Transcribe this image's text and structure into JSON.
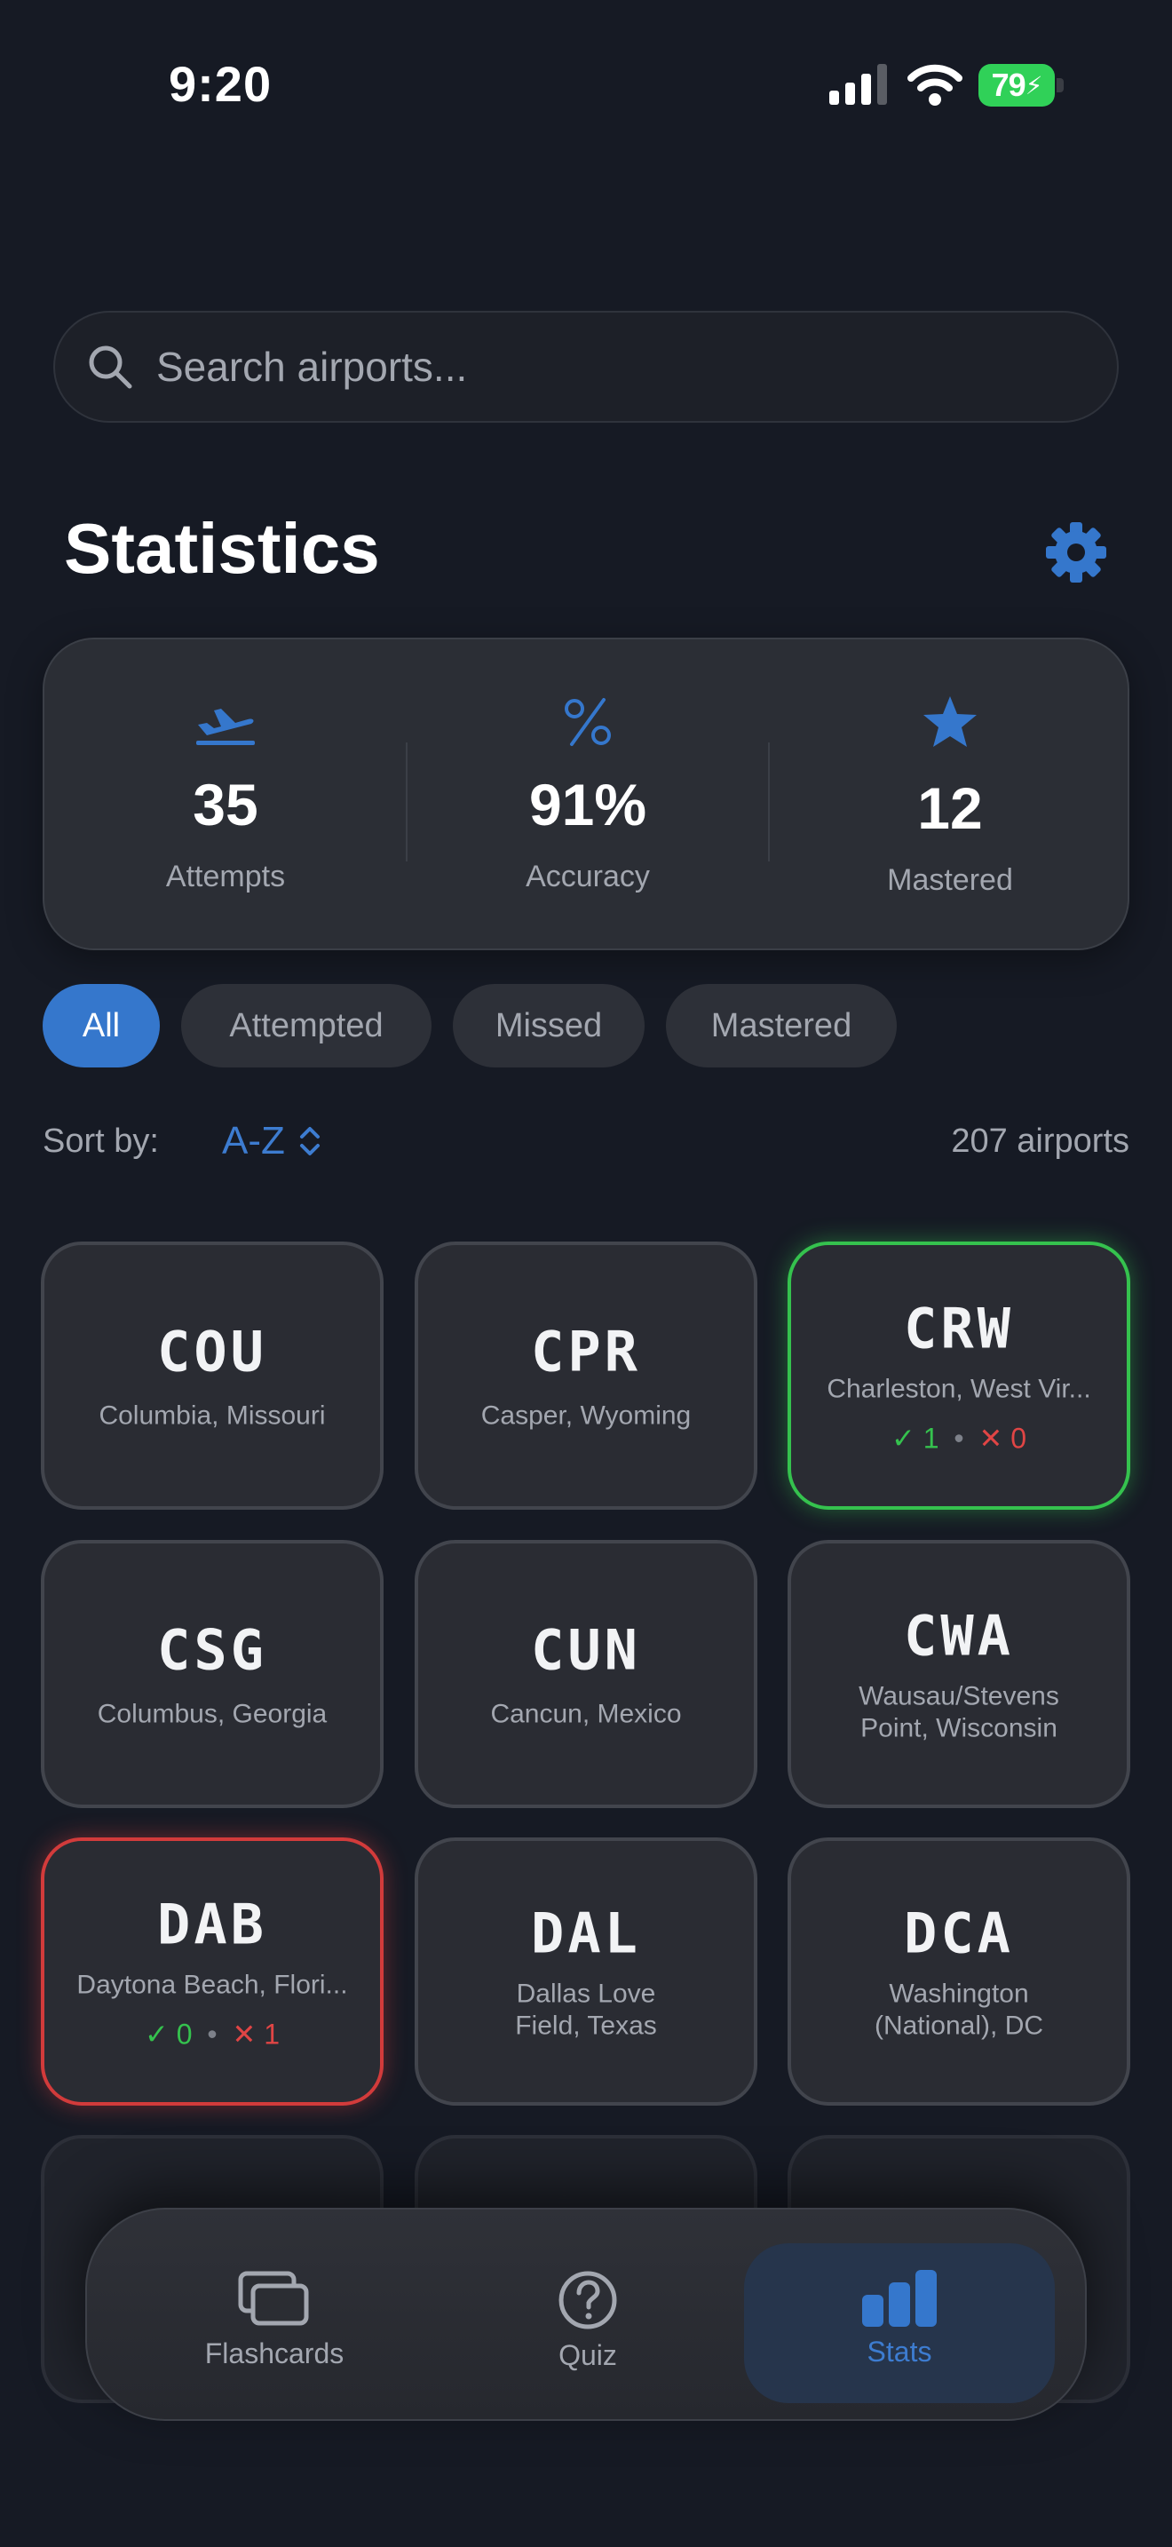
{
  "status": {
    "time": "9:20",
    "battery": "79"
  },
  "search": {
    "placeholder": "Search airports..."
  },
  "title": "Statistics",
  "stats": [
    {
      "icon": "plane-departure-icon",
      "value": "35",
      "label": "Attempts"
    },
    {
      "icon": "percent-icon",
      "value": "91%",
      "label": "Accuracy"
    },
    {
      "icon": "star-icon",
      "value": "12",
      "label": "Mastered"
    }
  ],
  "filters": [
    "All",
    "Attempted",
    "Missed",
    "Mastered"
  ],
  "active_filter": "All",
  "sort": {
    "label": "Sort by:",
    "value": "A-Z"
  },
  "count": "207 airports",
  "airports": [
    {
      "code": "COU",
      "city": "Columbia, Missouri"
    },
    {
      "code": "CPR",
      "city": "Casper, Wyoming"
    },
    {
      "code": "CRW",
      "city": "Charleston, West Vir...",
      "correct": "1",
      "wrong": "0",
      "state": "mastered"
    },
    {
      "code": "CSG",
      "city": "Columbus, Georgia"
    },
    {
      "code": "CUN",
      "city": "Cancun, Mexico"
    },
    {
      "code": "CWA",
      "city": "Wausau/Stevens Point, Wisconsin"
    },
    {
      "code": "DAB",
      "city": "Daytona Beach, Flori...",
      "correct": "0",
      "wrong": "1",
      "state": "missed"
    },
    {
      "code": "DAL",
      "city": "Dallas Love Field, Texas"
    },
    {
      "code": "DCA",
      "city": "Washington (National), DC"
    }
  ],
  "score_marks": {
    "check": "✓",
    "cross": "✕",
    "sep": "•"
  },
  "tabs": [
    {
      "label": "Flashcards",
      "icon": "cards-icon"
    },
    {
      "label": "Quiz",
      "icon": "question-circle-icon"
    },
    {
      "label": "Stats",
      "icon": "bar-chart-icon"
    }
  ],
  "colors": {
    "accent": "#3577cc",
    "success": "#35c24e",
    "danger": "#d23b3b",
    "background": "#161a24",
    "card": "#2a2c33"
  }
}
